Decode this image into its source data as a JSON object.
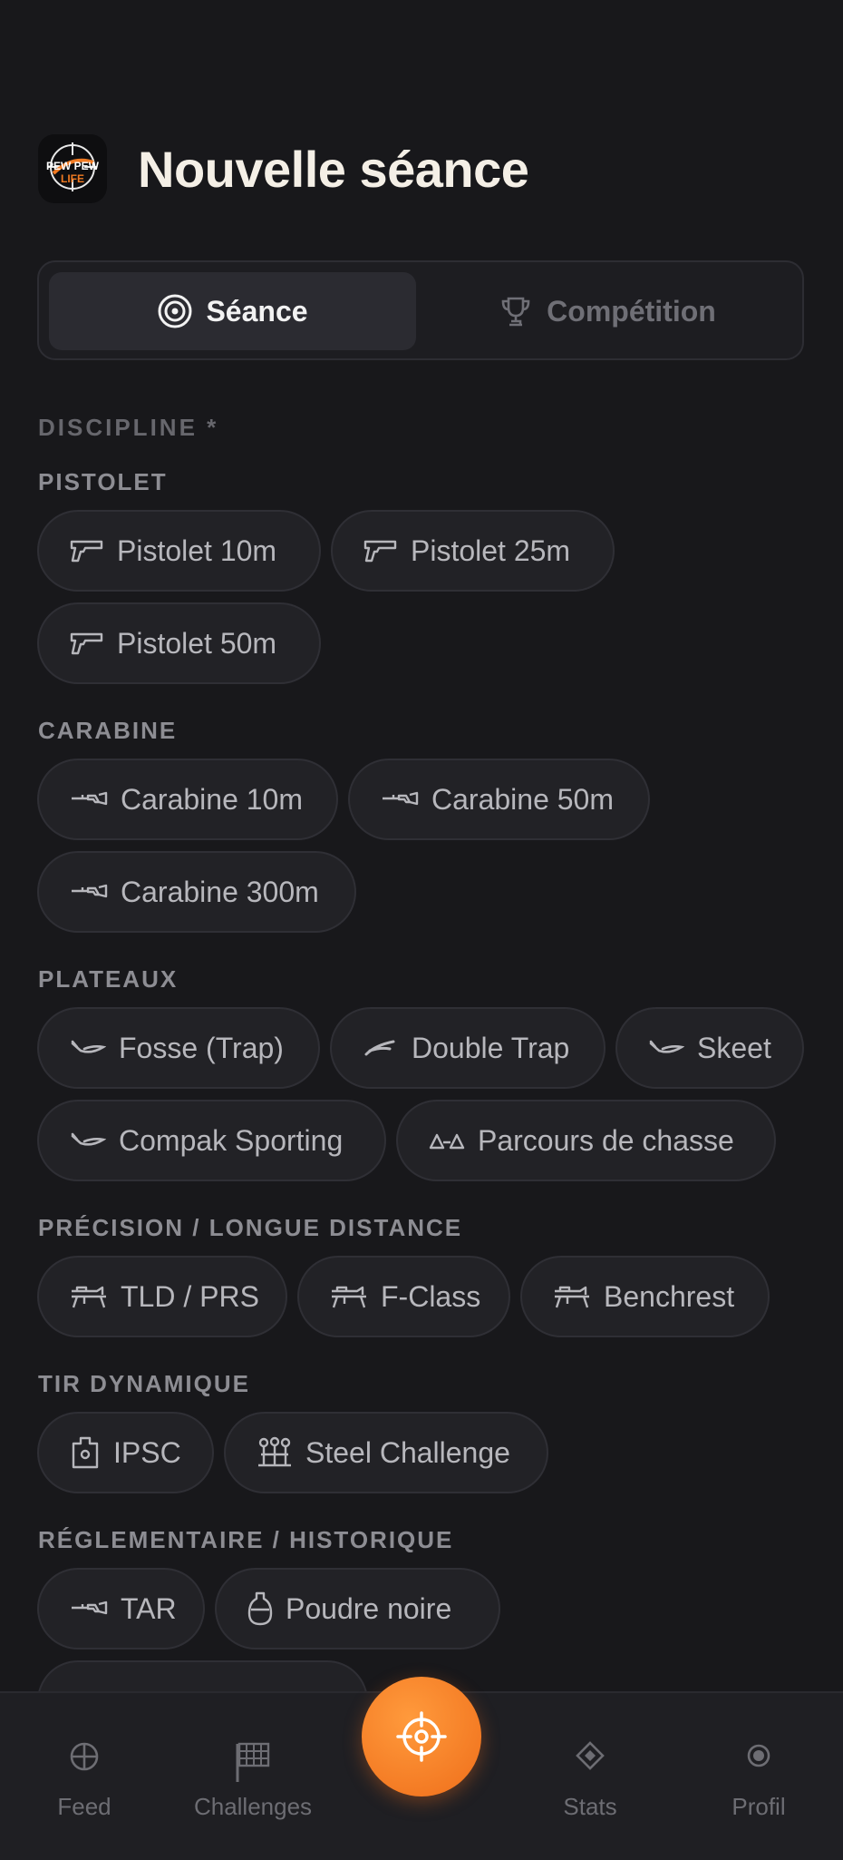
{
  "header": {
    "title": "Nouvelle séance",
    "logo_text_top": "PEW PEW",
    "logo_text_bottom": "LIFE"
  },
  "mode_toggle": {
    "session_label": "Séance",
    "competition_label": "Compétition",
    "selected": "session"
  },
  "discipline_label": "DISCIPLINE *",
  "sections": {
    "pistolet": {
      "label": "PISTOLET",
      "chips": [
        "Pistolet 10m",
        "Pistolet 25m",
        "Pistolet 50m"
      ]
    },
    "carabine": {
      "label": "CARABINE",
      "chips": [
        "Carabine 10m",
        "Carabine 50m",
        "Carabine 300m"
      ]
    },
    "plateaux": {
      "label": "PLATEAUX",
      "chips": [
        "Fosse (Trap)",
        "Double Trap",
        "Skeet",
        "Compak Sporting",
        "Parcours de chasse"
      ]
    },
    "precision": {
      "label": "PRÉCISION / LONGUE DISTANCE",
      "chips": [
        "TLD / PRS",
        "F-Class",
        "Benchrest"
      ]
    },
    "dynamique": {
      "label": "TIR DYNAMIQUE",
      "chips": [
        "IPSC",
        "Steel Challenge"
      ]
    },
    "reglementaire": {
      "label": "RÉGLEMENTAIRE / HISTORIQUE",
      "chips": [
        "TAR",
        "Poudre noire"
      ]
    }
  },
  "nav": {
    "feed": "Feed",
    "challenges": "Challenges",
    "stats": "Stats",
    "profil": "Profil"
  },
  "colors": {
    "accent": "#f07a22",
    "background": "#18181b",
    "chip": "#222226"
  }
}
